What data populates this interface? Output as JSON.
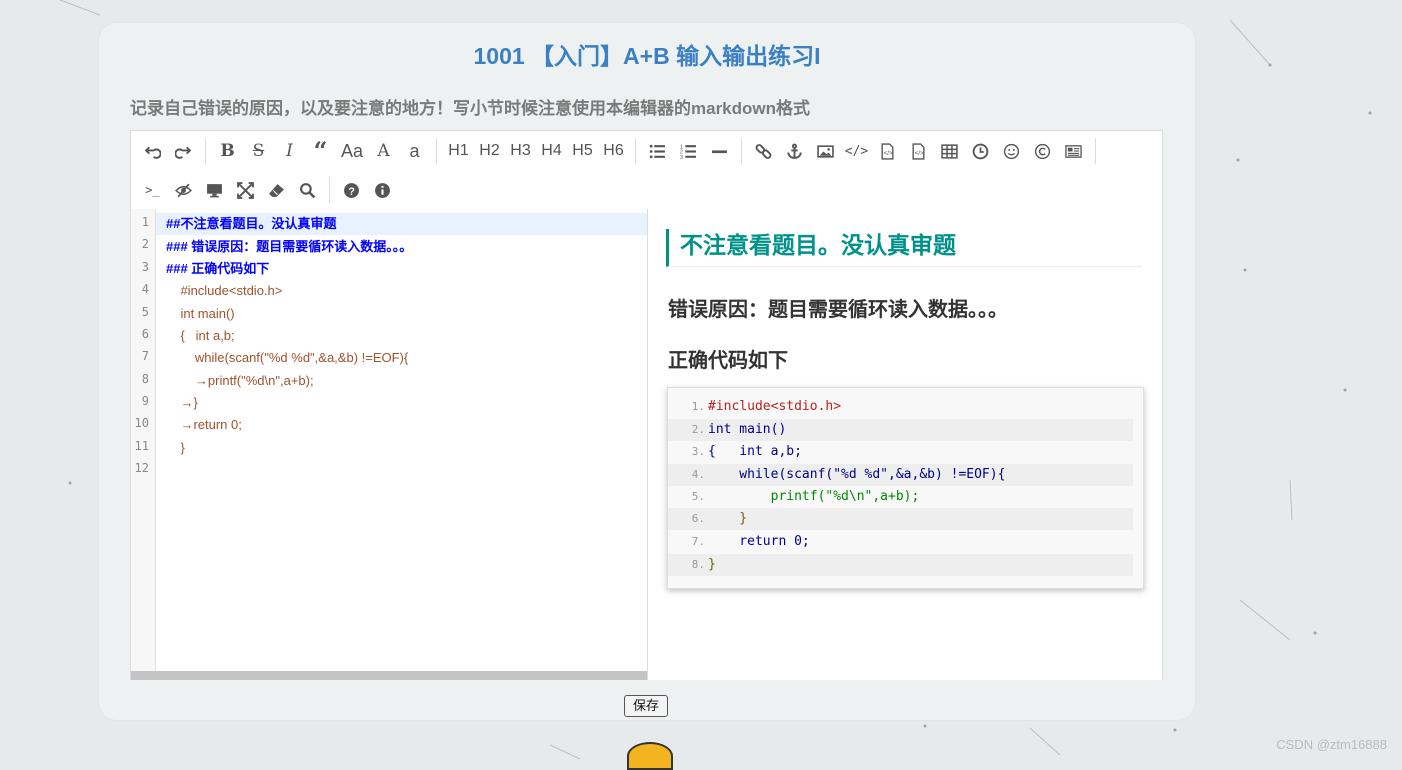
{
  "page": {
    "title": "1001 【入门】A+B 输入输出练习I",
    "subtitle": "记录自己错误的原因，以及要注意的地方！写小节时候注意使用本编辑器的markdown格式",
    "save_label": "保存",
    "watermark": "CSDN @ztm16888"
  },
  "toolbar": {
    "headings": [
      "H1",
      "H2",
      "H3",
      "H4",
      "H5",
      "H6"
    ],
    "bold": "B",
    "strike": "S",
    "italic": "I",
    "uppercase": "Aa",
    "font_a": "A",
    "lowercase": "a",
    "terminal": ">_"
  },
  "editor": {
    "line_numbers": [
      "1",
      "2",
      "3",
      "4",
      "5",
      "6",
      "7",
      "8",
      "9",
      "10",
      "11",
      "12"
    ],
    "lines": [
      "##不注意看题目。没认真审题",
      "### 错误原因：题目需要循环读入数据。。。",
      "### 正确代码如下",
      "    #include<stdio.h>",
      "    int main()",
      "    {   int a,b;",
      "        while(scanf(\"%d %d\",&a,&b) !=EOF){",
      "        →printf(\"%d\\n\",a+b);",
      "    →}",
      "    →return 0;",
      "    }",
      ""
    ]
  },
  "preview": {
    "h1": "不注意看题目。没认真审题",
    "h3_error": "错误原因：题目需要循环读入数据。。。",
    "h3_code": "正确代码如下",
    "code_line_numbers": [
      "1.",
      "2.",
      "3.",
      "4.",
      "5.",
      "6.",
      "7.",
      "8."
    ],
    "code_lines": [
      "#include<stdio.h>",
      "int main()",
      "{   int a,b;",
      "    while(scanf(\"%d %d\",&a,&b) !=EOF){",
      "        printf(\"%d\\n\",a+b);",
      "    }",
      "    return 0;",
      "}"
    ]
  }
}
